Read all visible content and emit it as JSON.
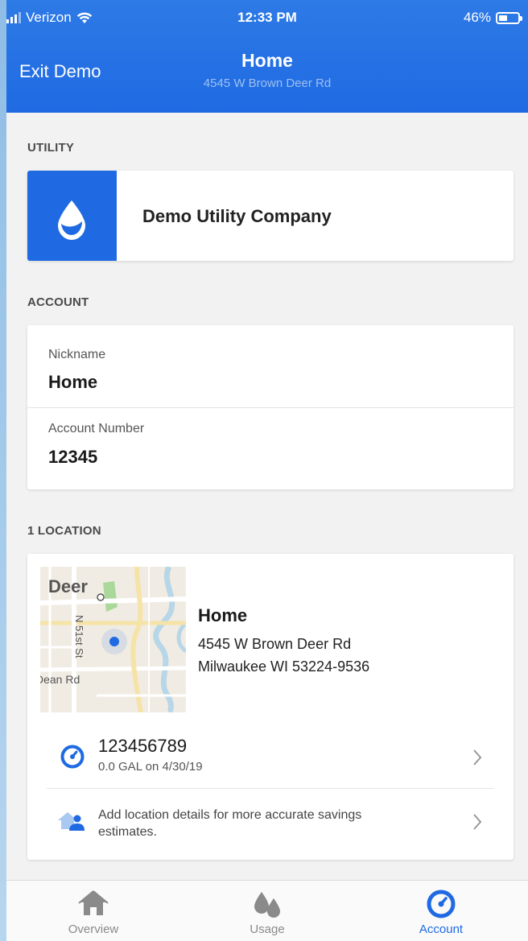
{
  "status_bar": {
    "carrier": "Verizon",
    "time": "12:33 PM",
    "battery": "46%",
    "battery_level": 0.46
  },
  "header": {
    "back_label": "Exit Demo",
    "title": "Home",
    "subtitle": "4545 W Brown Deer Rd"
  },
  "utility": {
    "section_label": "UTILITY",
    "name": "Demo Utility Company",
    "icon": "water-drop-icon"
  },
  "account": {
    "section_label": "ACCOUNT",
    "nickname_label": "Nickname",
    "nickname_value": "Home",
    "number_label": "Account Number",
    "number_value": "12345"
  },
  "location": {
    "section_label": "1 LOCATION",
    "map": {
      "label_deer": "Deer",
      "label_street": "N 51st St",
      "label_dean": "Dean Rd"
    },
    "name": "Home",
    "address_line1": "4545 W Brown Deer Rd",
    "address_line2": "Milwaukee WI 53224-9536",
    "meter": {
      "id": "123456789",
      "reading": "0.0 GAL on 4/30/19",
      "icon": "meter-gauge-icon"
    },
    "details_prompt": {
      "text": "Add location details for more accurate savings estimates.",
      "icon": "house-person-icon"
    }
  },
  "tabbar": {
    "tabs": [
      {
        "label": "Overview",
        "icon": "house-icon",
        "active": false
      },
      {
        "label": "Usage",
        "icon": "water-drops-icon",
        "active": false
      },
      {
        "label": "Account",
        "icon": "meter-gauge-icon",
        "active": true
      }
    ]
  },
  "colors": {
    "primary": "#1f6ae2",
    "background": "#f2f2f2",
    "card": "#ffffff"
  }
}
